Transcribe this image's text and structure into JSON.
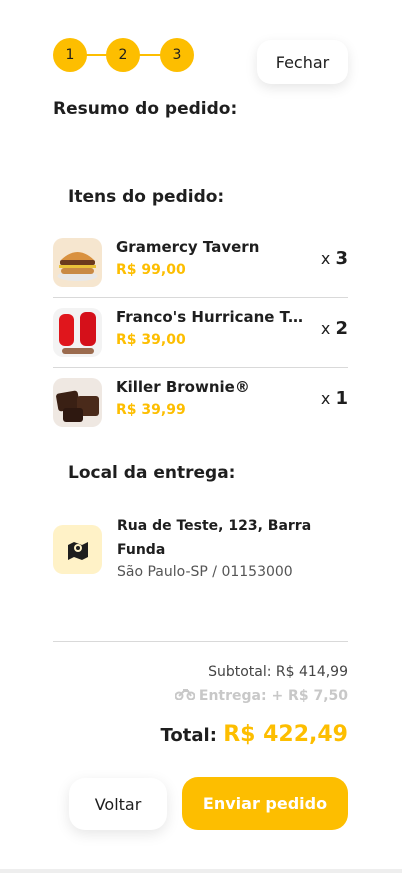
{
  "stepper": {
    "steps": [
      "1",
      "2",
      "3"
    ],
    "current": 3
  },
  "header": {
    "close_label": "Fechar",
    "title": "Resumo do pedido:"
  },
  "items_section": {
    "title": "Itens do pedido:",
    "items": [
      {
        "name": "Gramercy Tavern",
        "price": "R$ 99,00",
        "qty_prefix": "x",
        "qty": "3",
        "icon": "burger-photo"
      },
      {
        "name": "Franco's Hurricane Tarts",
        "price": "R$ 39,00",
        "qty_prefix": "x",
        "qty": "2",
        "icon": "tarts-photo"
      },
      {
        "name": "Killer Brownie®",
        "price": "R$ 39,99",
        "qty_prefix": "x",
        "qty": "1",
        "icon": "brownie-photo"
      }
    ]
  },
  "delivery_section": {
    "title": "Local da entrega:",
    "icon": "map-icon",
    "address_line1": "Rua de Teste, 123, Barra Funda",
    "address_line2": "São Paulo-SP / 01153000"
  },
  "summary": {
    "subtotal": "Subtotal: R$ 414,99",
    "delivery": "Entrega: + R$ 7,50",
    "delivery_icon": "motorcycle-icon",
    "total_label": "Total:",
    "total_value": "R$ 422,49"
  },
  "actions": {
    "back_label": "Voltar",
    "send_label": "Enviar pedido"
  },
  "colors": {
    "accent": "#FDBE00",
    "accent_light": "#FFF2C7",
    "text": "#1e1e1e",
    "muted": "#c8c8c8"
  }
}
